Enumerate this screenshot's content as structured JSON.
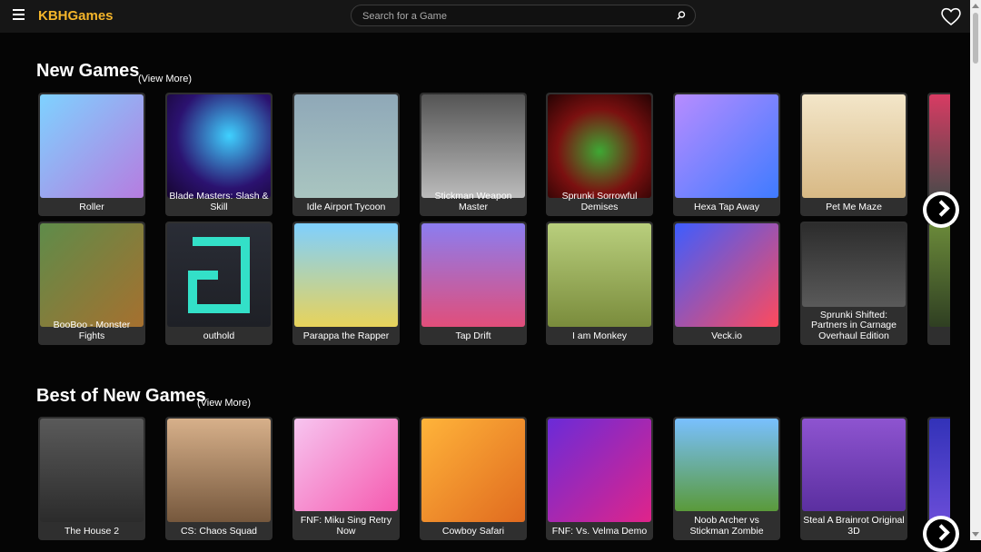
{
  "header": {
    "logo": "KBHGames",
    "search_placeholder": "Search for a Game",
    "icons": {
      "menu": "hamburger-menu-icon",
      "search": "search-icon",
      "favorites": "heart-icon"
    }
  },
  "sections": [
    {
      "title": "New Games",
      "view_more": "(View More)",
      "rows": [
        [
          "Roller",
          "Blade Masters: Slash & Skill",
          "Idle Airport Tycoon",
          "Stickman Weapon Master",
          "Sprunki Sorrowful Demises",
          "Hexa Tap Away",
          "Pet Me Maze",
          ""
        ],
        [
          "BooBoo - Monster Fights",
          "outhold",
          "Parappa the Rapper",
          "Tap Drift",
          "I am Monkey",
          "Veck.io",
          "Sprunki Shifted: Partners in Carnage Overhaul Edition",
          ""
        ]
      ]
    },
    {
      "title": "Best of New Games",
      "view_more": "(View More)",
      "rows": [
        [
          "The House 2",
          "CS: Chaos Squad",
          "FNF: Miku Sing Retry Now",
          "Cowboy Safari",
          "FNF: Vs. Velma Demo",
          "Noob Archer vs Stickman Zombie",
          "Steal A Brainrot Original 3D",
          ""
        ]
      ]
    }
  ],
  "colors": {
    "accent": "#f4b52a",
    "background": "#050505",
    "card": "#2f2f2f"
  }
}
